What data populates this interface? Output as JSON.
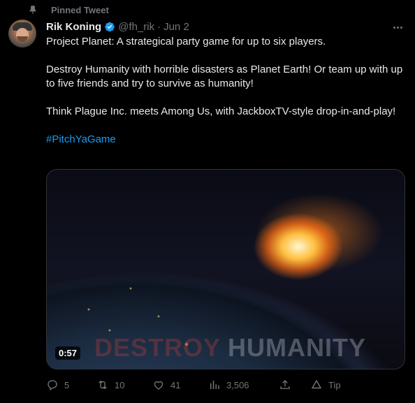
{
  "pinned": {
    "label": "Pinned Tweet"
  },
  "author": {
    "name": "Rik Koning",
    "handle": "@fh_rik",
    "separator": "·",
    "date": "Jun 2"
  },
  "tweet": {
    "line1": "Project Planet: A strategical party game for up to six players.",
    "line2": "Destroy Humanity with horrible disasters as Planet Earth! Or team up with up to five friends and try to survive as humanity!",
    "line3": "Think Plague Inc. meets Among Us, with JackboxTV-style drop-in-and-play!",
    "hashtag": "#PitchYaGame"
  },
  "media": {
    "overlay_word1": "DESTROY",
    "overlay_word2": "HUMANITY",
    "duration": "0:57"
  },
  "actions": {
    "replies": "5",
    "retweets": "10",
    "likes": "41",
    "views": "3,506",
    "tip": "Tip"
  },
  "colors": {
    "accent": "#1d9bf0",
    "muted": "#71767b",
    "text": "#e7e9ea",
    "background": "#000000"
  }
}
